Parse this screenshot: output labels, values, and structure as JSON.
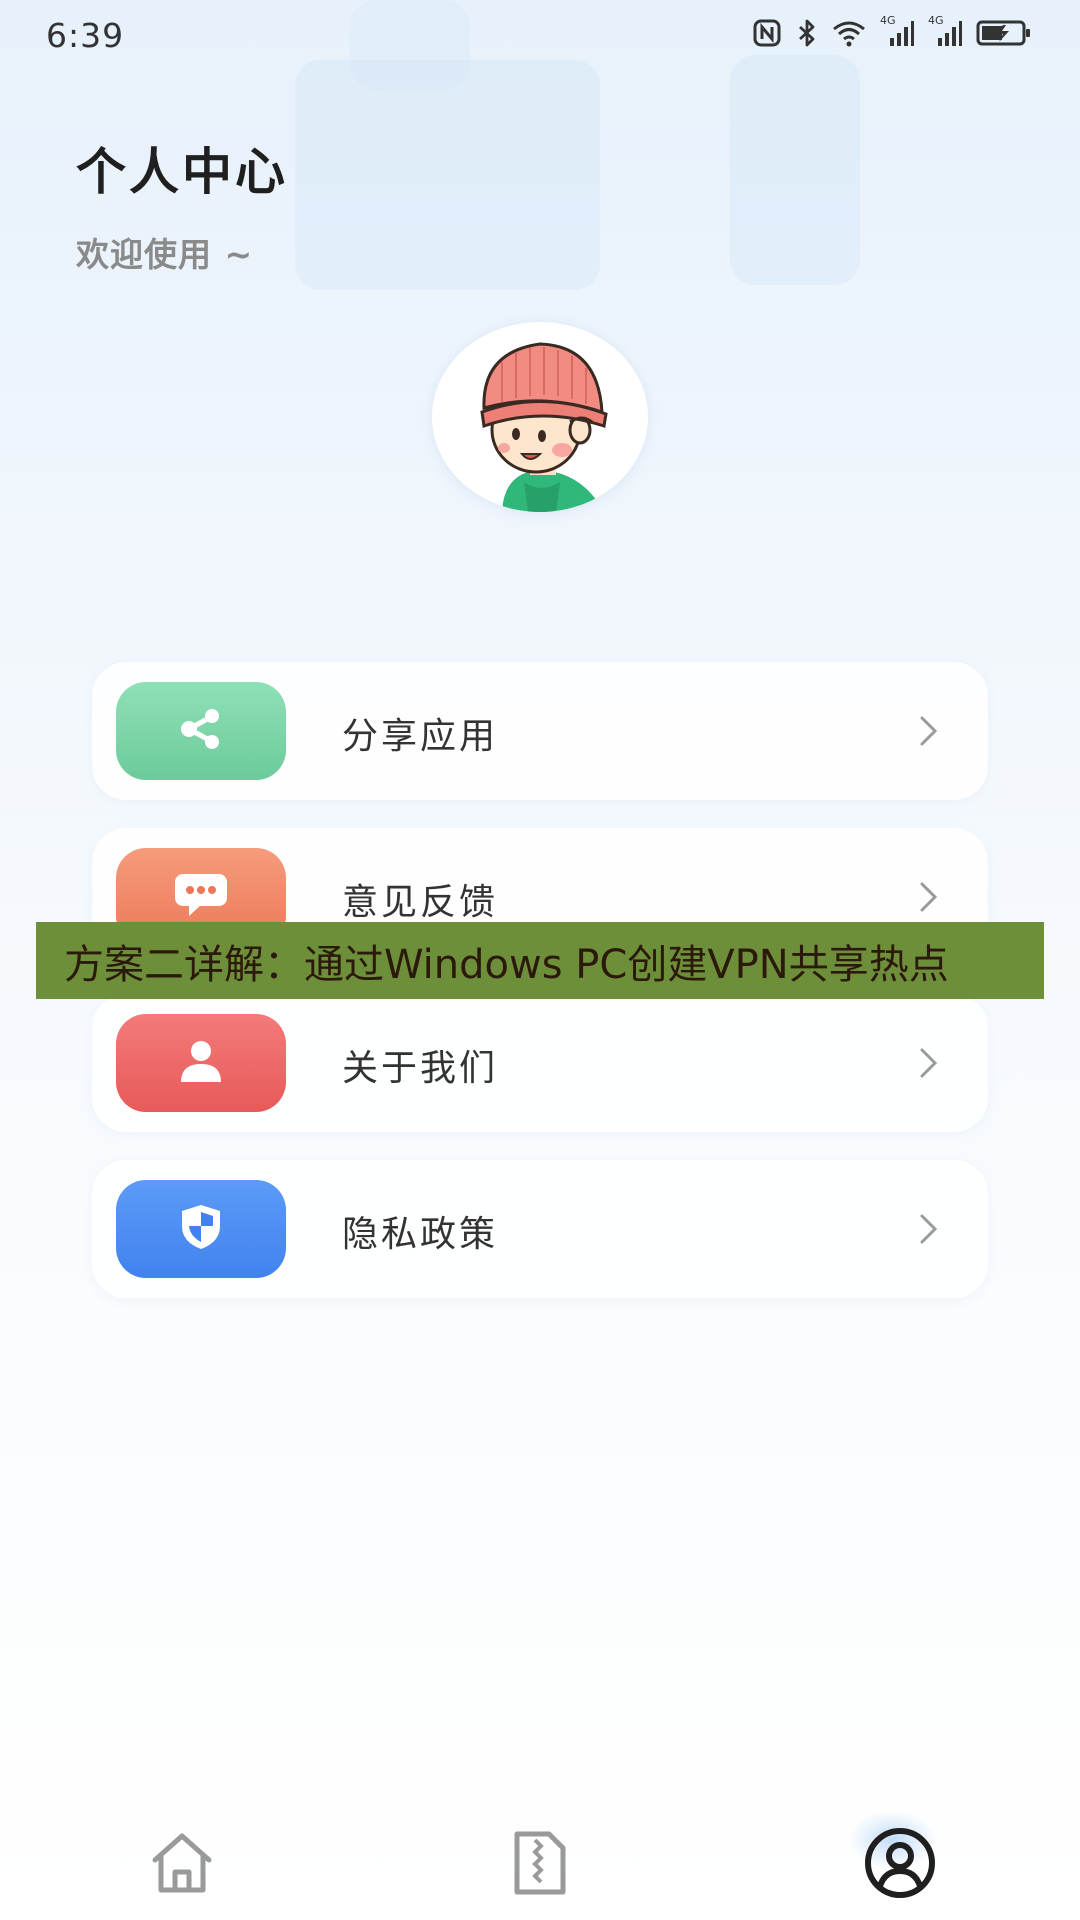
{
  "status_bar": {
    "time": "6:39",
    "network_1": "4G",
    "network_2": "4G",
    "icons": [
      "nfc-icon",
      "bluetooth-icon",
      "wifi-icon",
      "signal-icon",
      "signal-icon",
      "battery-charging-icon"
    ]
  },
  "header": {
    "title": "个人中心",
    "subtitle": "欢迎使用 ~"
  },
  "menu": {
    "items": [
      {
        "label": "分享应用",
        "icon": "share-icon",
        "color": "#7fd6a8"
      },
      {
        "label": "意见反馈",
        "icon": "chat-bubble-icon",
        "color": "#f08a6a"
      },
      {
        "label": "关于我们",
        "icon": "user-icon",
        "color": "#ee6b6b"
      },
      {
        "label": "隐私政策",
        "icon": "shield-icon",
        "color": "#4f8ef5"
      }
    ]
  },
  "banner": {
    "text": "方案二详解：通过Windows PC创建VPN共享热点",
    "color": "#6e8f3a"
  },
  "bottom_nav": {
    "items": [
      {
        "icon": "home-icon",
        "active": false
      },
      {
        "icon": "document-icon",
        "active": false
      },
      {
        "icon": "profile-icon",
        "active": true
      }
    ]
  }
}
